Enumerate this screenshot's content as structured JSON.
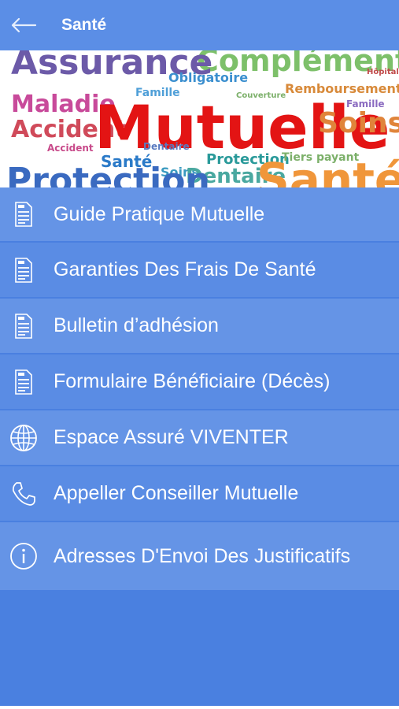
{
  "header": {
    "title": "Santé",
    "back_icon": "arrow-left-icon"
  },
  "banner": {
    "words": {
      "w1": "Mutuelle",
      "w2": "Assurance",
      "w3": "Maladie",
      "w4": "Accident",
      "w5": "Protection",
      "w6": "Santé",
      "w7": "Soins",
      "w8": "Dentaire",
      "w9": "Remboursements",
      "w10": "Obligatoire",
      "w11": "Famille",
      "w12": "Complémentaire",
      "w13": "Tiers payant",
      "w14": "Hôpital",
      "w15": "Couverture",
      "w16": "Protection",
      "w17": "Santé",
      "w18": "Soins",
      "w19": "Accident",
      "w20": "Famille"
    }
  },
  "menu": {
    "items": [
      {
        "label": "Guide Pratique Mutuelle",
        "icon": "pdf-document-icon"
      },
      {
        "label": "Garanties Des Frais De Santé",
        "icon": "pdf-document-icon"
      },
      {
        "label": "Bulletin d’adhésion",
        "icon": "pdf-document-icon"
      },
      {
        "label": "Formulaire Bénéficiaire (Décès)",
        "icon": "pdf-document-icon"
      },
      {
        "label": "Espace Assuré VIVENTER",
        "icon": "globe-icon"
      },
      {
        "label": "Appeller Conseiller Mutuelle",
        "icon": "phone-icon"
      },
      {
        "label": "Adresses D'Envoi Des Justificatifs",
        "icon": "info-icon"
      }
    ]
  },
  "colors": {
    "background": "#4a80e0",
    "header": "#5b8ee6",
    "row_light": "#6594e6",
    "row_dark": "#5a8ce4",
    "text": "#ffffff"
  }
}
